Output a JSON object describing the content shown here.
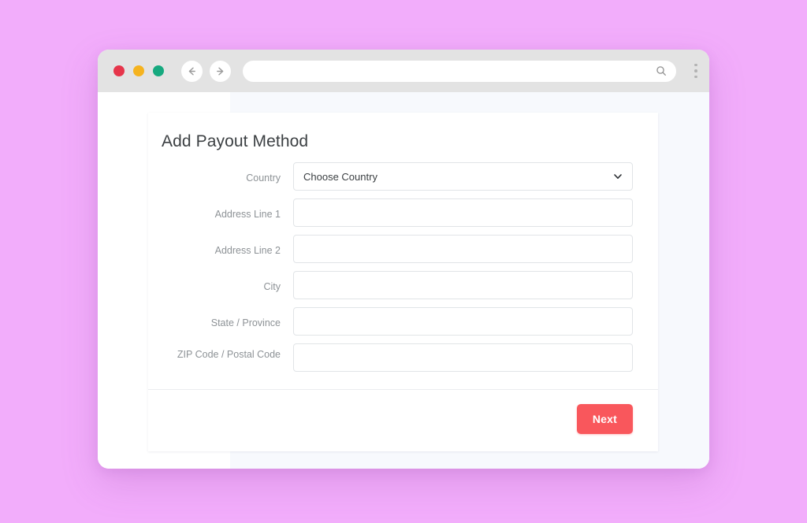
{
  "background": {
    "color": "#f2adfb"
  },
  "browser": {
    "traffic_lights": [
      {
        "name": "close",
        "color": "#e6354b"
      },
      {
        "name": "minimize",
        "color": "#f5b31f"
      },
      {
        "name": "maximize",
        "color": "#16a97f"
      }
    ],
    "nav": {
      "back_icon": "arrow-left-icon",
      "forward_icon": "arrow-right-icon"
    },
    "address_bar": {
      "value": "",
      "placeholder": "",
      "icon": "search-icon"
    },
    "menu_icon": "kebab-menu-icon"
  },
  "card": {
    "title": "Add Payout Method",
    "fields": [
      {
        "label": "Country",
        "type": "select",
        "value": "Choose Country",
        "placeholder": "Choose Country",
        "icon": "chevron-down-icon"
      },
      {
        "label": "Address Line 1",
        "type": "text",
        "value": "",
        "placeholder": ""
      },
      {
        "label": "Address Line 2",
        "type": "text",
        "value": "",
        "placeholder": ""
      },
      {
        "label": "City",
        "type": "text",
        "value": "",
        "placeholder": ""
      },
      {
        "label": "State / Province",
        "type": "text",
        "value": "",
        "placeholder": ""
      },
      {
        "label": "ZIP Code / Postal Code",
        "type": "text",
        "value": "",
        "placeholder": ""
      }
    ],
    "footer": {
      "next_label": "Next",
      "next_color": "#f9575c"
    }
  }
}
